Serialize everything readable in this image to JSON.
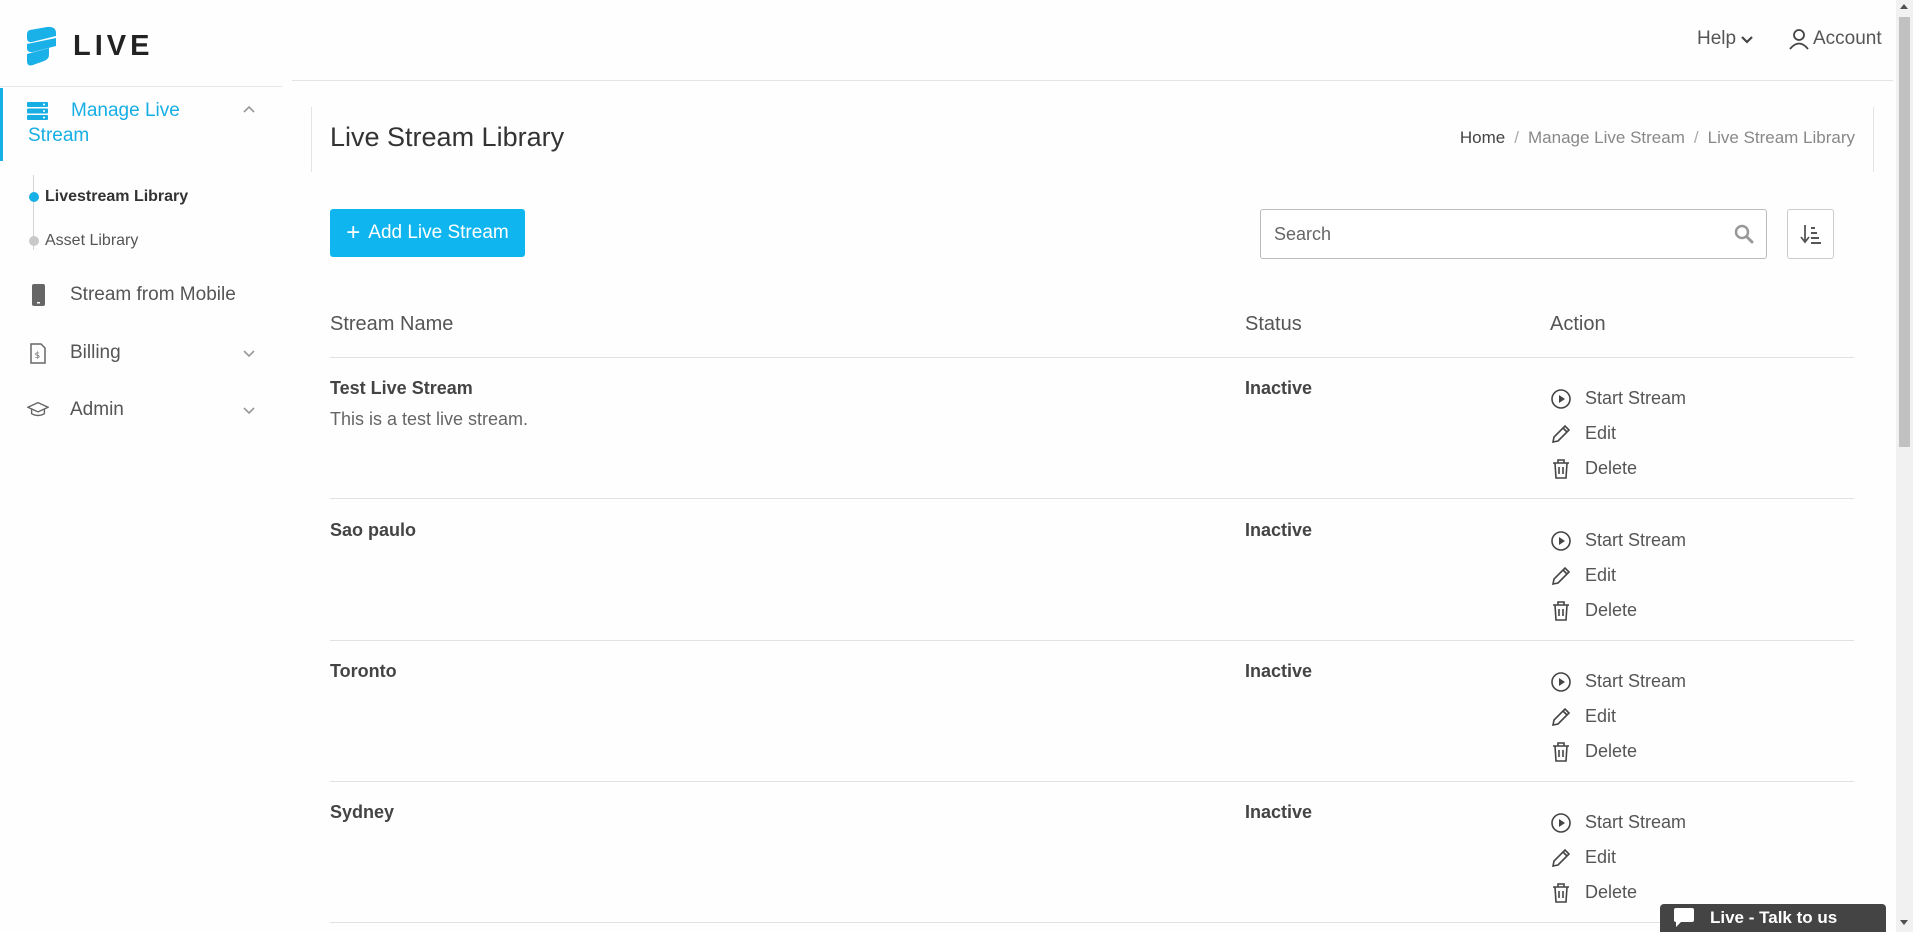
{
  "app": {
    "logo_text": "LIVE"
  },
  "sidebar": {
    "manage": {
      "label": "Manage Live Stream"
    },
    "subitems": [
      {
        "label": "Livestream Library"
      },
      {
        "label": "Asset Library"
      }
    ],
    "items": [
      {
        "label": "Stream from Mobile"
      },
      {
        "label": "Billing"
      },
      {
        "label": "Admin"
      }
    ]
  },
  "topbar": {
    "help_label": "Help",
    "account_label": "Account"
  },
  "page": {
    "title": "Live Stream Library",
    "breadcrumb": [
      "Home",
      "Manage Live Stream",
      "Live Stream Library"
    ]
  },
  "toolbar": {
    "add_label": "Add Live Stream",
    "search_placeholder": "Search"
  },
  "table": {
    "headers": [
      "Stream Name",
      "Status",
      "Action"
    ],
    "action_labels": {
      "start": "Start Stream",
      "edit": "Edit",
      "delete": "Delete"
    },
    "rows": [
      {
        "name": "Test Live Stream",
        "description": "This is a test live stream.",
        "status": "Inactive"
      },
      {
        "name": "Sao paulo",
        "description": "",
        "status": "Inactive"
      },
      {
        "name": "Toronto",
        "description": "",
        "status": "Inactive"
      },
      {
        "name": "Sydney",
        "description": "",
        "status": "Inactive"
      }
    ]
  },
  "chat": {
    "label": "Live - Talk to us"
  },
  "colors": {
    "accent": "#17b0e6",
    "button": "#0fb5ee",
    "chat": "#444444"
  }
}
